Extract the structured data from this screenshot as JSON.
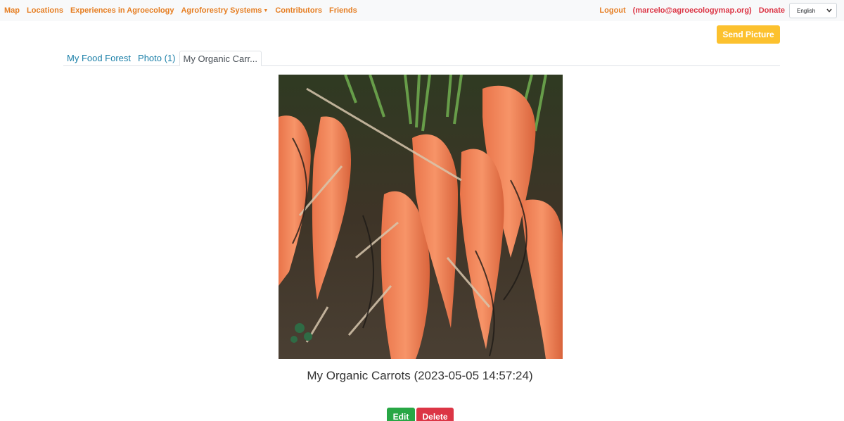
{
  "nav": {
    "items": [
      {
        "label": "Map"
      },
      {
        "label": "Locations"
      },
      {
        "label": "Experiences in Agroecology"
      },
      {
        "label": "Agroforestry Systems"
      },
      {
        "label": "Contributors"
      },
      {
        "label": "Friends"
      }
    ],
    "logout": "Logout",
    "user": "(marcelo@agroecologymap.org)",
    "donate": "Donate",
    "language": "English",
    "caret_icon": "caret-down-icon"
  },
  "send_picture": "Send Picture",
  "breadcrumb": {
    "tabs": [
      {
        "label": "My Food Forest"
      },
      {
        "label": "Photo (1)"
      },
      {
        "label": "My Organic Carr..."
      }
    ]
  },
  "photo": {
    "caption": "My Organic Carrots (2023-05-05 14:57:24)"
  },
  "actions": {
    "edit": "Edit",
    "delete": "Delete"
  },
  "colors": {
    "nav_link": "#e67e22",
    "nav_link_red": "#dc3545",
    "send_button": "#fcc12e",
    "edit_button": "#28a745",
    "delete_button": "#dc3545",
    "tab_link": "#1a7fa8"
  }
}
